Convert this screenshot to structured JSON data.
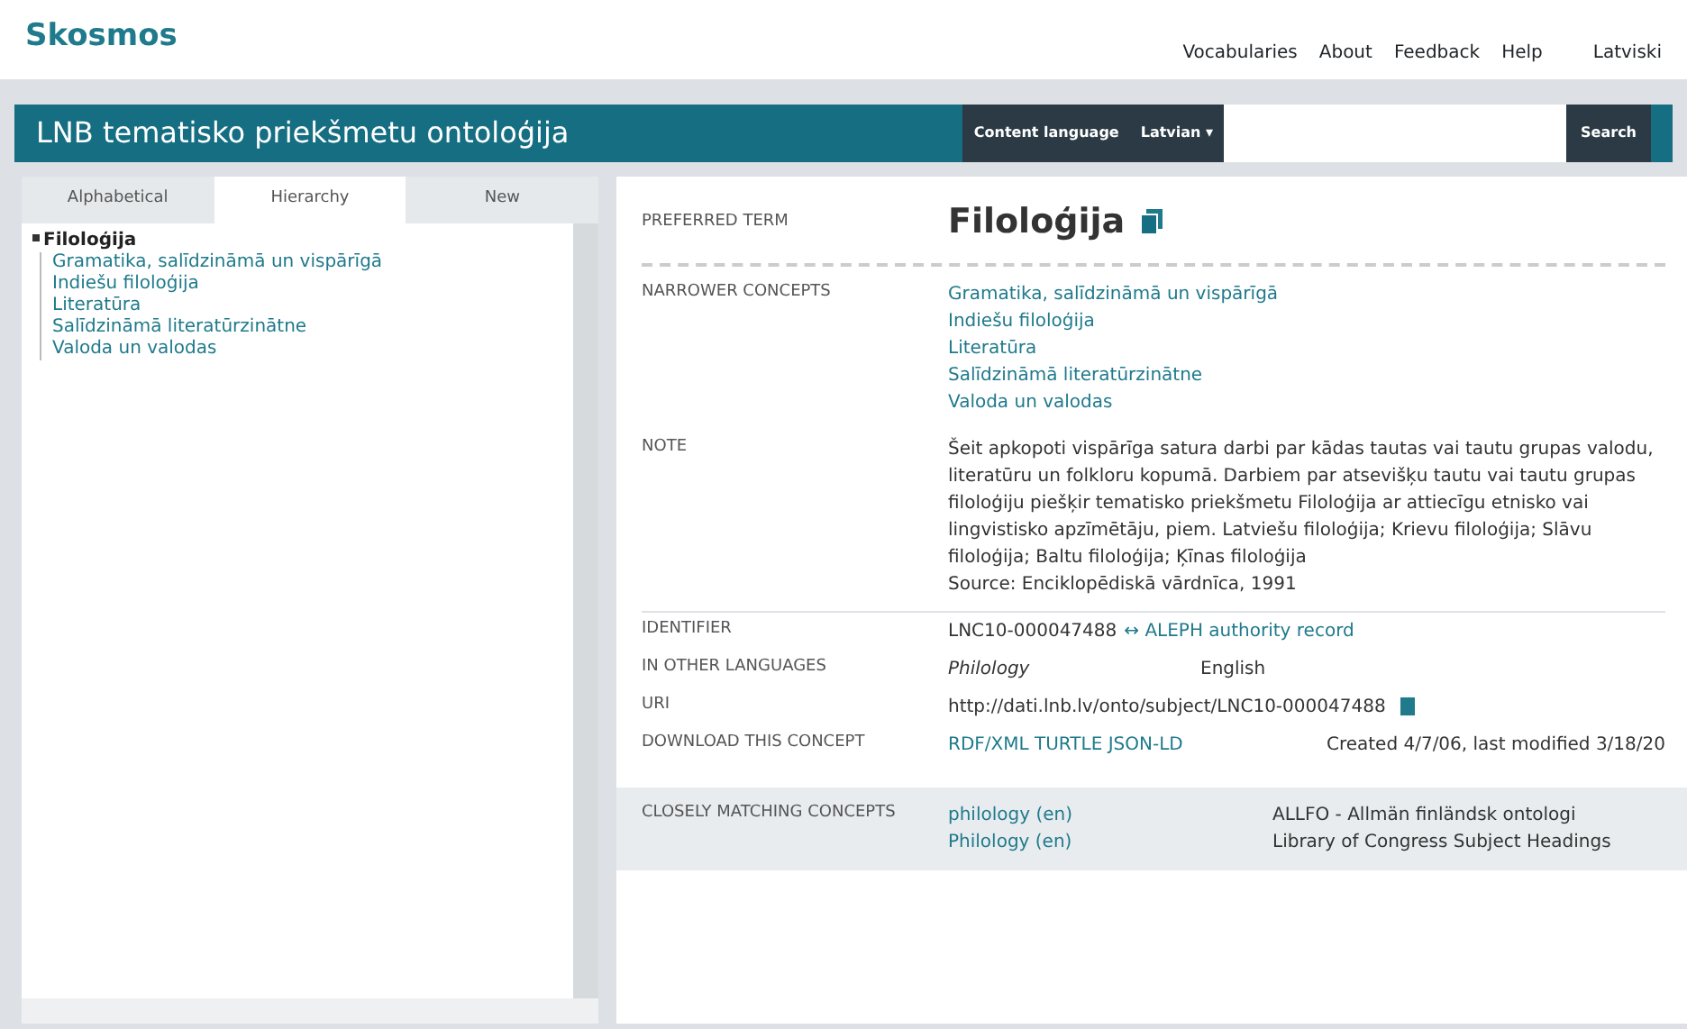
{
  "brand": "Skosmos",
  "top_nav": [
    "Vocabularies",
    "About",
    "Feedback",
    "Help"
  ],
  "language_link": "Latviski",
  "vocabulary_title": "LNB tematisko priekšmetu ontoloģija",
  "search": {
    "language_label": "Content language",
    "language_value": "Latvian ▾",
    "button": "Search"
  },
  "tabs": [
    {
      "label": "Alphabetical",
      "selected": false
    },
    {
      "label": "Hierarchy",
      "selected": true
    },
    {
      "label": "New",
      "selected": false
    }
  ],
  "tree": [
    {
      "label": "Filoloģija",
      "selected": true,
      "children": [
        {
          "label": "Gramatika, salīdzināmā un vispārīgā",
          "selected": false
        },
        {
          "label": "Indiešu filoloģija",
          "selected": false
        },
        {
          "label": "Literatūra",
          "selected": false
        },
        {
          "label": "Salīdzināmā literatūrzinātne",
          "selected": false
        },
        {
          "label": "Valoda un valodas",
          "selected": false
        }
      ]
    }
  ],
  "concept": {
    "preferred_label": "PREFERRED TERM",
    "preferred_term": "Filoloģija",
    "narrower_label": "NARROWER CONCEPTS",
    "narrower": [
      "Gramatika, salīdzināmā un vispārīgā",
      "Indiešu filoloģija",
      "Literatūra",
      "Salīdzināmā literatūrzinātne",
      "Valoda un valodas"
    ],
    "note_label": "NOTE",
    "note": "Šeit apkopoti vispārīga satura darbi par kādas tautas vai tautu grupas valodu, literatūru un folkloru kopumā. Darbiem par atsevišķu tautu vai tautu grupas filoloģiju piešķir tematisko priekšmetu Filoloģija ar attiecīgu etnisko vai lingvistisko apzīmētāju, piem. Latviešu filoloģija; Krievu filoloģija; Slāvu filoloģija; Baltu filoloģija; Ķīnas filoloģija",
    "source": "Source: Enciklopēdiskā vārdnīca, 1991",
    "identifier_label": "IDENTIFIER",
    "identifier": "LNC10-000047488",
    "identifier_link": "↔ ALEPH authority record",
    "languages_label": "IN OTHER LANGUAGES",
    "other_term": "Philology",
    "other_language": "English",
    "uri_label": "URI",
    "uri": "http://dati.lnb.lv/onto/subject/LNC10-000047488",
    "download_label": "DOWNLOAD THIS CONCEPT",
    "download": "RDF/XML TURTLE JSON-LD",
    "dates": "Created 4/7/06, last modified 3/18/20",
    "matches_label": "CLOSELY MATCHING CONCEPTS",
    "matches": [
      {
        "term": "philology (en)",
        "source": "ALLFO - Allmän finländsk ontologi"
      },
      {
        "term": "Philology (en)",
        "source": "Library of Congress Subject Headings"
      }
    ]
  }
}
